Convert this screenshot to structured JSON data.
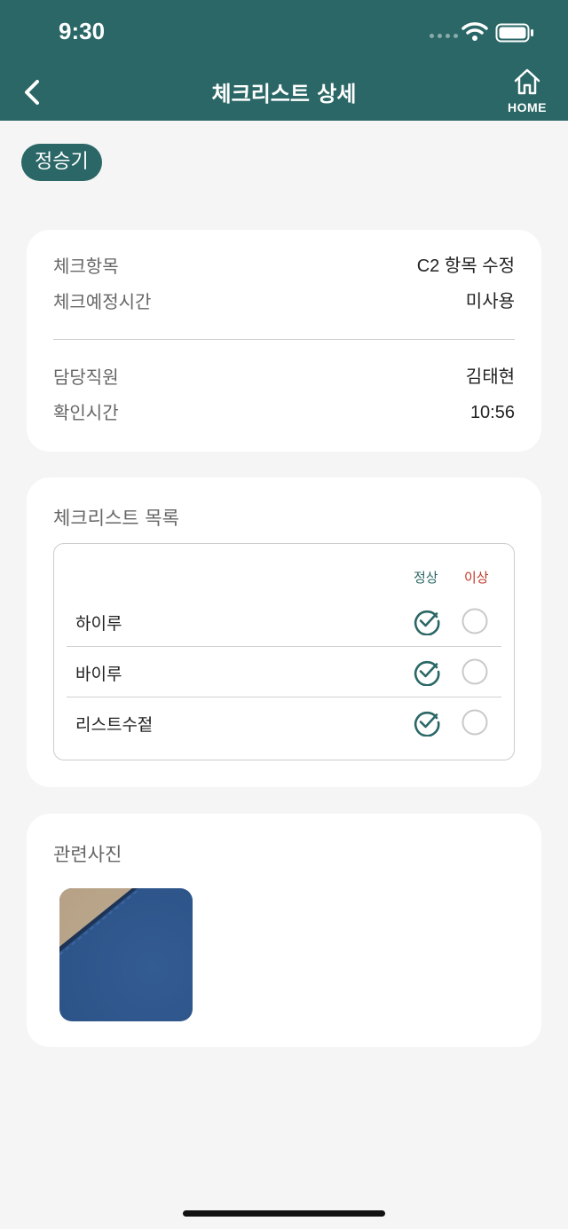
{
  "status_bar": {
    "time": "9:30"
  },
  "header": {
    "title": "체크리스트 상세",
    "home_label": "HOME"
  },
  "badge": "정승기",
  "info": {
    "check_item_label": "체크항목",
    "check_item_value": "C2 항목 수정",
    "scheduled_time_label": "체크예정시간",
    "scheduled_time_value": "미사용",
    "staff_label": "담당직원",
    "staff_value": "김태현",
    "confirm_time_label": "확인시간",
    "confirm_time_value": "10:56"
  },
  "checklist": {
    "title": "체크리스트 목록",
    "col_normal": "정상",
    "col_abnormal": "이상",
    "items": [
      {
        "label": "하이루",
        "normal": true,
        "abnormal": false
      },
      {
        "label": "바이루",
        "normal": true,
        "abnormal": false
      },
      {
        "label": "리스트수젙",
        "normal": true,
        "abnormal": false
      }
    ]
  },
  "photos": {
    "title": "관련사진"
  },
  "colors": {
    "primary": "#2a6766",
    "abnormal": "#c0392b",
    "background": "#f5f5f5"
  }
}
